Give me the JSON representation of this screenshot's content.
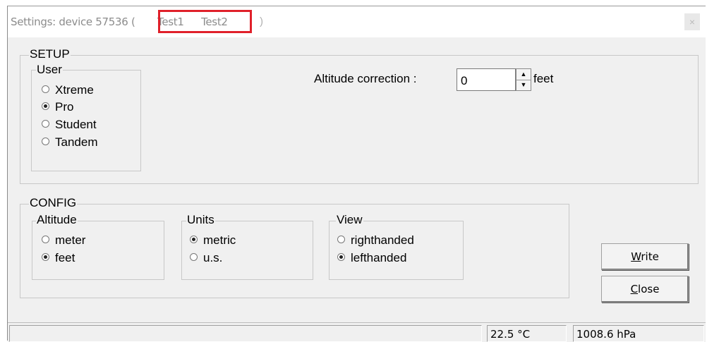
{
  "window": {
    "title": "Settings: device 57536 (",
    "tabs": [
      "Test1",
      "Test2"
    ],
    "title_close_paren": ")",
    "close_glyph": "×"
  },
  "setup": {
    "legend": "SETUP",
    "user": {
      "legend": "User",
      "options": [
        {
          "label": "Xtreme",
          "selected": false
        },
        {
          "label": "Pro",
          "selected": true
        },
        {
          "label": "Student",
          "selected": false
        },
        {
          "label": "Tandem",
          "selected": false
        }
      ]
    },
    "altitude_correction": {
      "label": "Altitude correction :",
      "value": "0",
      "unit": "feet"
    }
  },
  "config": {
    "legend": "CONFIG",
    "altitude": {
      "legend": "Altitude",
      "options": [
        {
          "label": "meter",
          "selected": false
        },
        {
          "label": "feet",
          "selected": true
        }
      ]
    },
    "units": {
      "legend": "Units",
      "options": [
        {
          "label": "metric",
          "selected": true
        },
        {
          "label": "u.s.",
          "selected": false
        }
      ]
    },
    "view": {
      "legend": "View",
      "options": [
        {
          "label": "righthanded",
          "selected": false
        },
        {
          "label": "lefthanded",
          "selected": true
        }
      ]
    }
  },
  "buttons": {
    "write": {
      "mnemonic": "W",
      "rest": "rite"
    },
    "close": {
      "mnemonic": "C",
      "rest": "lose"
    }
  },
  "status": {
    "message": "",
    "temperature": "22.5 °C",
    "pressure": "1008.6 hPa"
  },
  "colors": {
    "highlight": "#e0202a"
  }
}
